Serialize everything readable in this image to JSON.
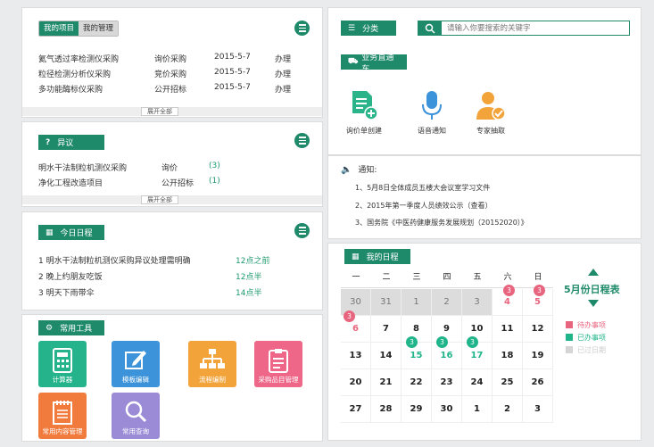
{
  "projects": {
    "tabs": [
      "我的项目",
      "我的管理"
    ],
    "rows": [
      {
        "name": "氦气透过率检测仪采购",
        "type": "询价采购",
        "date": "2015-5-7",
        "status": "办理"
      },
      {
        "name": "粒径检测分析仪采购",
        "type": "竞价采购",
        "date": "2015-5-7",
        "status": "办理"
      },
      {
        "name": "多功能酶标仪采购",
        "type": "公开招标",
        "date": "2015-5-7",
        "status": "办理"
      }
    ],
    "more": "展开全部"
  },
  "objections": {
    "title": "异议",
    "icon": "question-icon",
    "rows": [
      {
        "name": "明水干法制粒机测仪采购",
        "type": "询价",
        "count": "(3)"
      },
      {
        "name": "净化工程改造项目",
        "type": "公开招标",
        "count": "(1)"
      }
    ],
    "more": "展开全部"
  },
  "schedule": {
    "title": "今日日程",
    "icon": "calendar-icon",
    "rows": [
      {
        "text": "1 明水干法制粒机测仪采购异议处理需明确",
        "time": "12点之前"
      },
      {
        "text": "2 晚上约朋友吃饭",
        "time": "12点半"
      },
      {
        "text": "3 明天下雨带伞",
        "time": "14点半"
      }
    ]
  },
  "tools": {
    "title": "常用工具",
    "icon": "gear-icon",
    "items": [
      {
        "label": "计算器",
        "icon": "calculator-icon",
        "color": "#24b38a"
      },
      {
        "label": "模板编辑",
        "icon": "edit-icon",
        "color": "#3d93d9"
      },
      {
        "label": "流程编制",
        "icon": "flowchart-icon",
        "color": "#f2a33a"
      },
      {
        "label": "采购品目管理",
        "icon": "clipboard-icon",
        "color": "#ee6688"
      },
      {
        "label": "常用内容管理",
        "icon": "notebook-icon",
        "color": "#f07b3c"
      },
      {
        "label": "常用查询",
        "icon": "search-icon",
        "color": "#9b8bd6"
      }
    ]
  },
  "header": {
    "category_label": "分类",
    "search_placeholder": "请输入你要搜索的关键字"
  },
  "business": {
    "title": "业务直通车",
    "items": [
      {
        "label": "询价单创建",
        "icon": "document-add-icon",
        "color": "#2bb48a"
      },
      {
        "label": "语音通知",
        "icon": "microphone-icon",
        "color": "#3d93d9"
      },
      {
        "label": "专家抽取",
        "icon": "expert-icon",
        "color": "#f2a33a"
      }
    ]
  },
  "notices": {
    "title": "通知:",
    "items": [
      "1、5月8日全体成员五楼大会议室学习文件",
      "2、2015年第一季度人员绩效公示（查看）",
      "3、国务院《中医药健康服务发展规划（20152020）》"
    ]
  },
  "calendar": {
    "title": "我的日程",
    "month_title": "5月份日程表",
    "weekdays": [
      "一",
      "二",
      "三",
      "四",
      "五",
      "六",
      "日"
    ],
    "weeks": [
      [
        "30",
        "31",
        "1",
        "2",
        "3",
        "4",
        "5"
      ],
      [
        "6",
        "7",
        "8",
        "9",
        "10",
        "11",
        "12"
      ],
      [
        "13",
        "14",
        "15",
        "16",
        "17",
        "18",
        "19"
      ],
      [
        "20",
        "21",
        "22",
        "23",
        "24",
        "25",
        "26"
      ],
      [
        "27",
        "28",
        "29",
        "30",
        "1",
        "2",
        "3"
      ]
    ],
    "badges": [
      {
        "week": 0,
        "day": 5,
        "count": "3",
        "kind": "pending"
      },
      {
        "week": 0,
        "day": 6,
        "count": "3",
        "kind": "pending"
      },
      {
        "week": 1,
        "day": 0,
        "count": "3",
        "kind": "pending"
      },
      {
        "week": 2,
        "day": 2,
        "count": "3",
        "kind": "done"
      },
      {
        "week": 2,
        "day": 3,
        "count": "3",
        "kind": "done"
      },
      {
        "week": 2,
        "day": 4,
        "count": "3",
        "kind": "done"
      }
    ],
    "legend": [
      {
        "label": "待办事项",
        "color": "#e8657f"
      },
      {
        "label": "已办事项",
        "color": "#1fb489"
      },
      {
        "label": "已过日期",
        "color": "#d5d5d5"
      }
    ]
  }
}
